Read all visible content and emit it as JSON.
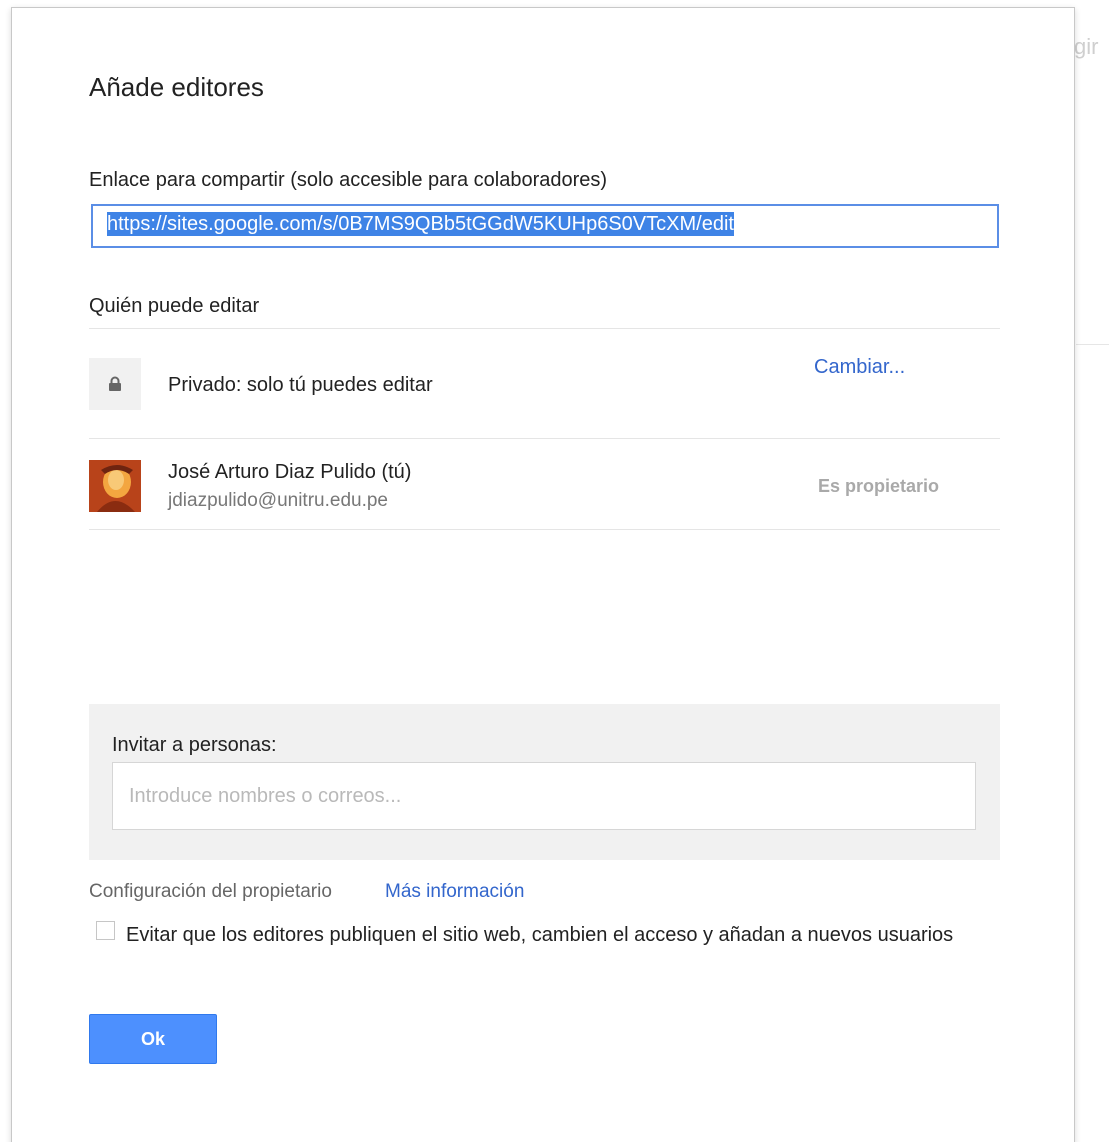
{
  "background": {
    "partial_text": "gir"
  },
  "dialog": {
    "title": "Añade editores",
    "share_link": {
      "label": "Enlace para compartir (solo accesible para colaboradores)",
      "value": "https://sites.google.com/s/0B7MS9QBb5tGGdW5KUHp6S0VTcXM/edit"
    },
    "who_can_edit": {
      "label": "Quién puede editar",
      "privacy": {
        "icon": "lock-icon",
        "text": "Privado: solo tú puedes editar",
        "change_label": "Cambiar..."
      },
      "users": [
        {
          "name": "José Arturo Diaz Pulido (tú)",
          "email": "jdiazpulido@unitru.edu.pe",
          "role": "Es propietario"
        }
      ]
    },
    "invite": {
      "label": "Invitar a personas:",
      "placeholder": "Introduce nombres o correos...",
      "value": ""
    },
    "owner_settings": {
      "label": "Configuración del propietario",
      "more_info": "Más información",
      "checkbox_label": "Evitar que los editores publiquen el sitio web, cambien el acceso y añadan a nuevos usuarios",
      "checked": false
    },
    "ok_label": "Ok"
  },
  "colors": {
    "accent_blue": "#4d90fe",
    "link_blue": "#3366cc",
    "selection_blue": "#3e83e6"
  }
}
